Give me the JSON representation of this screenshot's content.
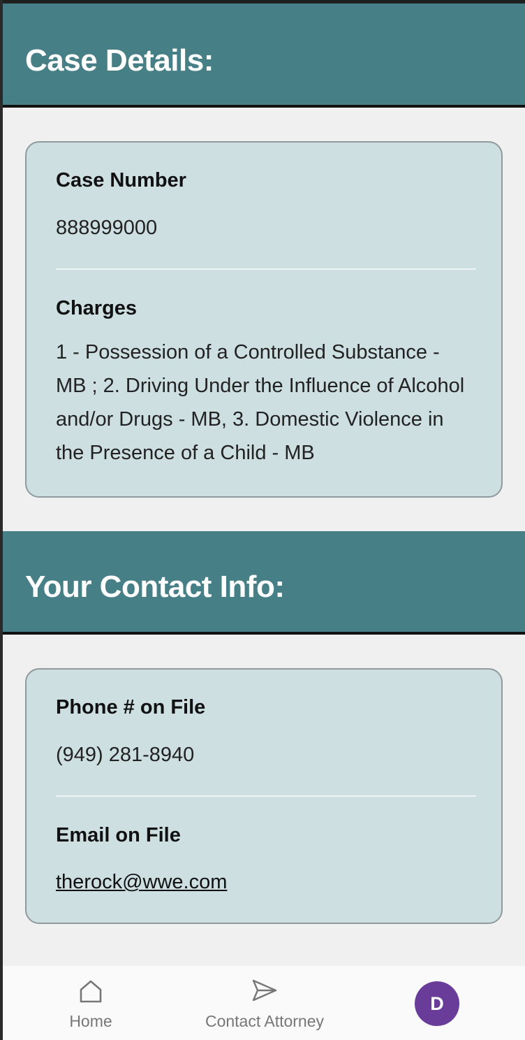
{
  "case_section": {
    "title": "Case Details:",
    "case_number_label": "Case Number",
    "case_number": "888999000",
    "charges_label": "Charges",
    "charges": "1 - Possession of a Controlled Substance - MB ; 2. Driving Under the Influence of Alcohol and/or Drugs - MB, 3. Domestic Violence in the Presence of a Child - MB"
  },
  "contact_section": {
    "title": "Your Contact Info:",
    "phone_label": "Phone # on File",
    "phone": "(949) 281-8940",
    "email_label": "Email on File",
    "email": "therock@wwe.com"
  },
  "bottom_nav": {
    "items": [
      {
        "label": "Home",
        "icon": "home-icon"
      },
      {
        "label": "Contact Attorney",
        "icon": "send-icon"
      }
    ],
    "avatar_initial": "D"
  },
  "colors": {
    "header": "#467f86",
    "card": "#cddfe1",
    "avatar": "#6a3c9a",
    "page_bg": "#f0f0f0"
  }
}
